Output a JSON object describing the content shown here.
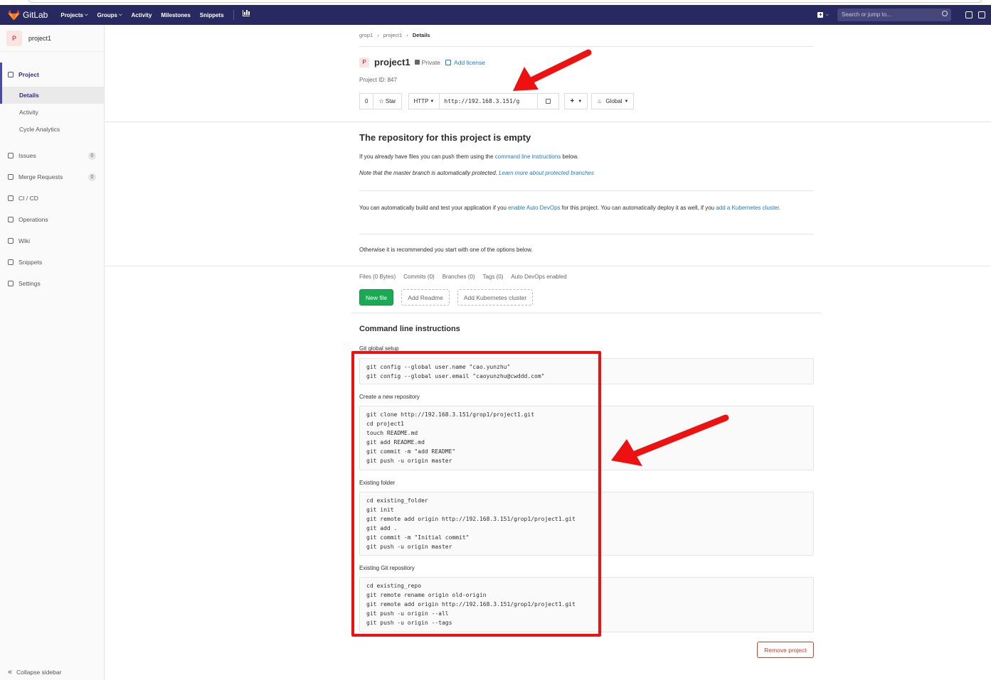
{
  "nav": {
    "brand": "GitLab",
    "links": [
      "Projects",
      "Groups",
      "Activity",
      "Milestones",
      "Snippets"
    ],
    "search_placeholder": "Search or jump to..."
  },
  "sidebar": {
    "project_initial": "P",
    "project_name": "project1",
    "project_section": "Project",
    "subitems": [
      "Details",
      "Activity",
      "Cycle Analytics"
    ],
    "items": [
      {
        "label": "Issues",
        "count": "0"
      },
      {
        "label": "Merge Requests",
        "count": "0"
      },
      {
        "label": "CI / CD"
      },
      {
        "label": "Operations"
      },
      {
        "label": "Wiki"
      },
      {
        "label": "Snippets"
      },
      {
        "label": "Settings"
      }
    ],
    "collapse": "Collapse sidebar"
  },
  "breadcrumb": [
    "grop1",
    "project1",
    "Details"
  ],
  "project": {
    "initial": "P",
    "name": "project1",
    "visibility": "Private",
    "add_license": "Add license",
    "id_text": "Project ID: 847",
    "star_count": "0",
    "star_label": "Star",
    "protocol": "HTTP",
    "clone_url": "http://192.168.3.151/g",
    "notification": "Global"
  },
  "empty": {
    "title": "The repository for this project is empty",
    "p1_pre": "If you already have files you can push them using the ",
    "p1_link": "command line instructions",
    "p1_post": " below.",
    "p2_pre": "Note that the master branch is automatically protected. ",
    "p2_link": "Learn more about protected branches",
    "p3_pre": "You can automatically build and test your application if you ",
    "p3_link1": "enable Auto DevOps",
    "p3_mid": " for this project. You can automatically deploy it as well, if you ",
    "p3_link2": "add a Kubernetes cluster",
    "p3_post": ".",
    "p4": "Otherwise it is recommended you start with one of the options below."
  },
  "stats": [
    "Files (0 Bytes)",
    "Commits (0)",
    "Branches (0)",
    "Tags (0)",
    "Auto DevOps enabled"
  ],
  "actions": {
    "new_file": "New file",
    "add_readme": "Add Readme",
    "add_k8s": "Add Kubernetes cluster"
  },
  "cli": {
    "title": "Command line instructions",
    "sections": [
      {
        "label": "Git global setup",
        "lines": [
          "git config --global user.name \"cao.yunzhu\"",
          "git config --global user.email \"caoyunzhu@cwddd.com\""
        ]
      },
      {
        "label": "Create a new repository",
        "lines": [
          "git clone http://192.168.3.151/grop1/project1.git",
          "cd project1",
          "touch README.md",
          "git add README.md",
          "git commit -m \"add README\"",
          "git push -u origin master"
        ]
      },
      {
        "label": "Existing folder",
        "lines": [
          "cd existing_folder",
          "git init",
          "git remote add origin http://192.168.3.151/grop1/project1.git",
          "git add .",
          "git commit -m \"Initial commit\"",
          "git push -u origin master"
        ]
      },
      {
        "label": "Existing Git repository",
        "lines": [
          "cd existing_repo",
          "git remote rename origin old-origin",
          "git remote add origin http://192.168.3.151/grop1/project1.git",
          "git push -u origin --all",
          "git push -u origin --tags"
        ]
      }
    ]
  },
  "remove_project": "Remove project",
  "colors": {
    "navbar": "#292961",
    "link": "#1f78d1",
    "success": "#1aaa55",
    "danger": "#db3b21",
    "annotation": "#ee1111"
  }
}
